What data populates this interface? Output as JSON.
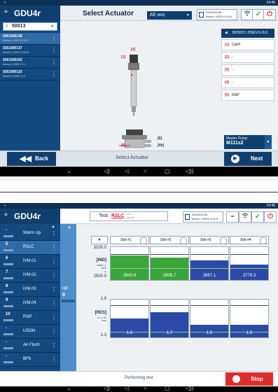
{
  "colors": {
    "brand_navy": "#0f3f6e",
    "sidebar_blue": "#134a80",
    "selected_blue": "#2f6ba7",
    "gauge_green": "#3aa63a",
    "gauge_blue": "#2b4aa8",
    "stop_red": "#e02b2b"
  },
  "screen1": {
    "status_time": "14:46",
    "app_title": "GDU4r",
    "page_title": "Select Actuator",
    "filter": {
      "label": "All",
      "count": "(469)"
    },
    "vci": {
      "line1": "0261500136",
      "line2": "Bosch | HDEV-5-2LS"
    },
    "search": {
      "value": "0261500136",
      "display": "50013",
      "placeholder": "Search"
    },
    "results": [
      {
        "code": "0261500136",
        "desc": "Bosch | HDEV-5-2LS"
      },
      {
        "code": "0261500137",
        "desc": "Bosch | HDEV-5-2LS"
      },
      {
        "code": "0261500102",
        "desc": "Bosch | HDEV 5.1"
      },
      {
        "code": "0261500133",
        "desc": "Bosch | HDEV 5.2"
      }
    ],
    "legend_header": "BOSCH | HDEV-5-2LS",
    "legend": [
      {
        "num": "[1]",
        "text": "CalVi"
      },
      {
        "num": "[2]",
        "text": "-"
      },
      {
        "num": "[3]",
        "text": "-"
      },
      {
        "num": "[4]",
        "text": "-"
      },
      {
        "num": "[5]",
        "text": "RSP"
      }
    ],
    "callouts": {
      "c4": "[4]",
      "c1": "[1]",
      "c5": "[5]",
      "c6": "[6]",
      "c4h": "[4h]"
    },
    "master_pump": {
      "label": "Master Pump:",
      "value": "M111x2"
    },
    "footer": {
      "back": "Back",
      "center": "Select Actuator",
      "next": "Next"
    }
  },
  "screen2": {
    "status_time": "14:48",
    "app_title": "GDU4r",
    "test": {
      "label": "Test:",
      "name": "R2LC",
      "sub1": "2.9 T",
      "sub2": "2.4 | 24"
    },
    "vci": {
      "line1": "0261500136",
      "line2": "Bosch | HDEV-5-2LS"
    },
    "sidebar": [
      {
        "num": "-",
        "label": "Warm Up"
      },
      {
        "num": "5",
        "label": "R2LC"
      },
      {
        "num": "6",
        "label": "iVM.01"
      },
      {
        "num": "7",
        "label": "iVM.02"
      },
      {
        "num": "8",
        "label": "iVM.03"
      },
      {
        "num": "9",
        "label": "iVM.04"
      },
      {
        "num": "10",
        "label": "RSP"
      },
      {
        "num": "-",
        "label": "USON"
      },
      {
        "num": "-",
        "label": "Air Flush"
      },
      {
        "num": "-",
        "label": "BFK"
      }
    ],
    "hp": {
      "label": "HP",
      "value": "0"
    },
    "slots": [
      "Slot #1",
      "Slot #2",
      "Slot #3",
      "Slot #4"
    ],
    "ind": {
      "top": "3100.0",
      "mid": "2500.0",
      "tag": "[IND]",
      "range1": "2808.8 +/-",
      "range2": "300.0",
      "unit": "uL"
    },
    "res": {
      "top": "1.9",
      "mid": "1.3",
      "tag": "[RES]",
      "range1": "1.6 +/- 0.3",
      "unit": "Ohm"
    },
    "ind_values": [
      "2943.9",
      "2905.7",
      "2857.1",
      "2779.3"
    ],
    "ind_levels": [
      0.74,
      0.68,
      0.6,
      0.47
    ],
    "ind_colors": [
      "green",
      "green",
      "blue",
      "blue"
    ],
    "res_values": [
      "1.6",
      "1.7",
      "1.5",
      "1.5"
    ],
    "res_levels": [
      0.5,
      0.67,
      0.33,
      0.33
    ],
    "footer": {
      "status": "Performing test",
      "stop": "Stop"
    }
  }
}
